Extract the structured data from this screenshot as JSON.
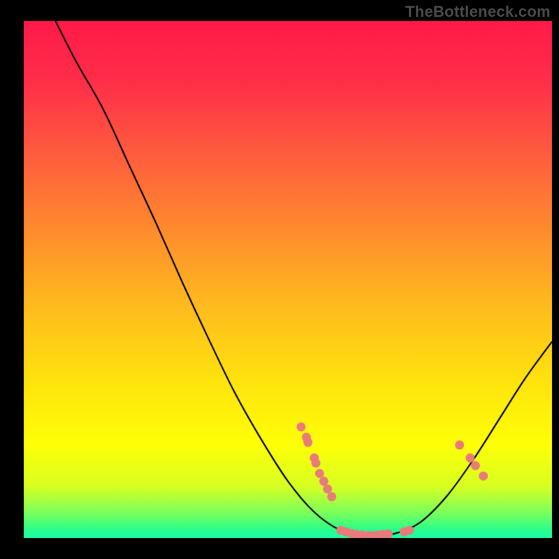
{
  "watermark": "TheBottleneck.com",
  "chart_data": {
    "type": "line",
    "title": "",
    "xlabel": "",
    "ylabel": "",
    "xlim": [
      0,
      100
    ],
    "ylim": [
      0,
      100
    ],
    "background_gradient_stops": [
      {
        "pos": 0.0,
        "color": "#ff1a4a"
      },
      {
        "pos": 0.12,
        "color": "#ff2f49"
      },
      {
        "pos": 0.25,
        "color": "#ff5a3f"
      },
      {
        "pos": 0.4,
        "color": "#ff8a2e"
      },
      {
        "pos": 0.55,
        "color": "#ffbb1e"
      },
      {
        "pos": 0.7,
        "color": "#ffe40e"
      },
      {
        "pos": 0.82,
        "color": "#ffff07"
      },
      {
        "pos": 0.9,
        "color": "#d8ff22"
      },
      {
        "pos": 0.95,
        "color": "#7dff5a"
      },
      {
        "pos": 0.985,
        "color": "#27ff8e"
      },
      {
        "pos": 1.0,
        "color": "#1cffa6"
      }
    ],
    "curve": [
      {
        "x": 6.0,
        "y": 100.0
      },
      {
        "x": 10.0,
        "y": 92.0
      },
      {
        "x": 15.0,
        "y": 83.0
      },
      {
        "x": 20.0,
        "y": 72.0
      },
      {
        "x": 25.0,
        "y": 61.0
      },
      {
        "x": 30.0,
        "y": 49.5
      },
      {
        "x": 35.0,
        "y": 38.5
      },
      {
        "x": 40.0,
        "y": 28.0
      },
      {
        "x": 45.0,
        "y": 19.0
      },
      {
        "x": 50.0,
        "y": 11.0
      },
      {
        "x": 55.0,
        "y": 5.0
      },
      {
        "x": 60.0,
        "y": 1.5
      },
      {
        "x": 65.0,
        "y": 0.5
      },
      {
        "x": 70.0,
        "y": 0.8
      },
      {
        "x": 75.0,
        "y": 3.0
      },
      {
        "x": 80.0,
        "y": 8.0
      },
      {
        "x": 85.0,
        "y": 15.0
      },
      {
        "x": 90.0,
        "y": 23.0
      },
      {
        "x": 95.0,
        "y": 31.0
      },
      {
        "x": 100.0,
        "y": 38.0
      }
    ],
    "markers": [
      {
        "x": 52.5,
        "y": 21.5
      },
      {
        "x": 53.5,
        "y": 19.5
      },
      {
        "x": 53.8,
        "y": 18.5
      },
      {
        "x": 55.0,
        "y": 15.5
      },
      {
        "x": 55.3,
        "y": 14.5
      },
      {
        "x": 56.0,
        "y": 12.5
      },
      {
        "x": 56.8,
        "y": 11.0
      },
      {
        "x": 57.5,
        "y": 9.5
      },
      {
        "x": 58.3,
        "y": 8.0
      },
      {
        "x": 60.0,
        "y": 1.5
      },
      {
        "x": 61.0,
        "y": 1.2
      },
      {
        "x": 62.0,
        "y": 0.9
      },
      {
        "x": 63.0,
        "y": 0.7
      },
      {
        "x": 64.0,
        "y": 0.6
      },
      {
        "x": 65.0,
        "y": 0.5
      },
      {
        "x": 66.0,
        "y": 0.5
      },
      {
        "x": 67.0,
        "y": 0.6
      },
      {
        "x": 68.0,
        "y": 0.7
      },
      {
        "x": 69.0,
        "y": 0.8
      },
      {
        "x": 72.0,
        "y": 1.2
      },
      {
        "x": 73.0,
        "y": 1.5
      },
      {
        "x": 82.5,
        "y": 18.0
      },
      {
        "x": 84.5,
        "y": 15.5
      },
      {
        "x": 85.5,
        "y": 14.0
      },
      {
        "x": 87.0,
        "y": 12.0
      }
    ],
    "marker_color": "#e97b7b",
    "curve_color": "#000000"
  }
}
